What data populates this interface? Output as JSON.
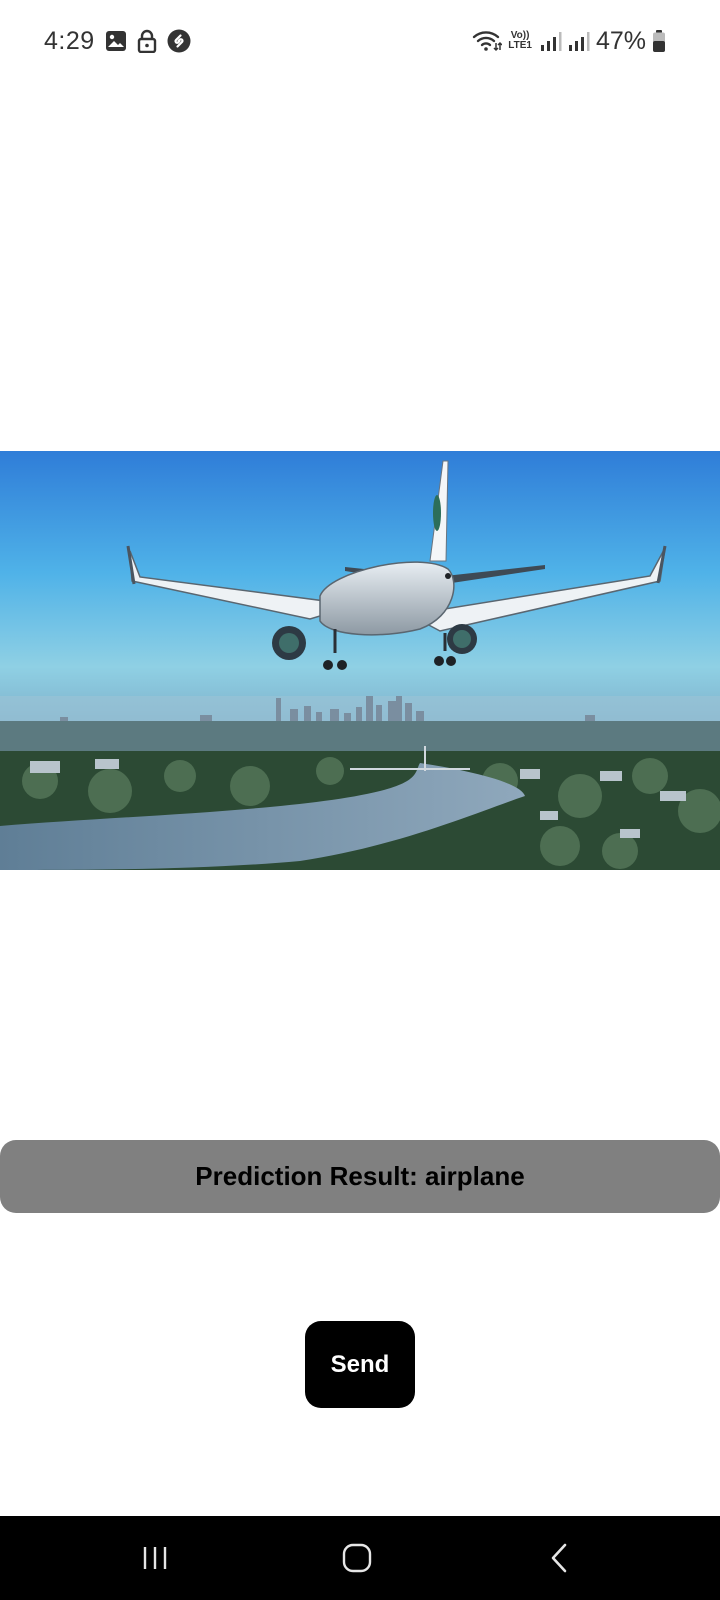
{
  "status_bar": {
    "time": "4:29",
    "battery_percent": "47%",
    "volte_top": "Vo))",
    "volte_bottom": "LTE1",
    "left_icons": [
      "gallery-icon",
      "lock-icon",
      "shazam-icon"
    ],
    "right_icons": [
      "wifi-icon",
      "signal-icon",
      "signal-icon",
      "battery-icon"
    ]
  },
  "photo": {
    "subject": "airplane",
    "icon": "photo-airplane-city"
  },
  "result": {
    "label": "Prediction Result: airplane"
  },
  "actions": {
    "send_label": "Send"
  },
  "navigation": {
    "recents_icon": "recents-icon",
    "home_icon": "home-icon",
    "back_icon": "back-icon"
  },
  "colors": {
    "result_bar": "#808080",
    "send_button": "#000000",
    "nav_bar": "#000000"
  }
}
